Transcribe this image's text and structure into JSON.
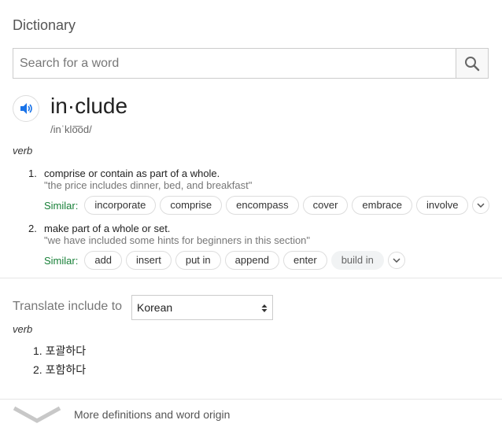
{
  "header": {
    "title": "Dictionary"
  },
  "search": {
    "placeholder": "Search for a word",
    "value": ""
  },
  "entry": {
    "word": "in·clude",
    "phonetic": "/inˈklo͞od/",
    "part_of_speech": "verb",
    "senses": [
      {
        "number": "1.",
        "definition": "comprise or contain as part of a whole.",
        "example": "\"the price includes dinner, bed, and breakfast\"",
        "similar_label": "Similar:",
        "similar": [
          "incorporate",
          "comprise",
          "encompass",
          "cover",
          "embrace",
          "involve"
        ]
      },
      {
        "number": "2.",
        "definition": "make part of a whole or set.",
        "example": "\"we have included some hints for beginners in this section\"",
        "similar_label": "Similar:",
        "similar": [
          "add",
          "insert",
          "put in",
          "append",
          "enter",
          "build in"
        ]
      }
    ]
  },
  "translate": {
    "label": "Translate include to",
    "language": "Korean",
    "part_of_speech": "verb",
    "items": [
      {
        "number": "1.",
        "text": "포괄하다"
      },
      {
        "number": "2.",
        "text": "포함하다"
      }
    ]
  },
  "footer": {
    "more_label": "More definitions and word origin"
  },
  "colors": {
    "accent": "#1a73e8",
    "similar_green": "#188038"
  }
}
